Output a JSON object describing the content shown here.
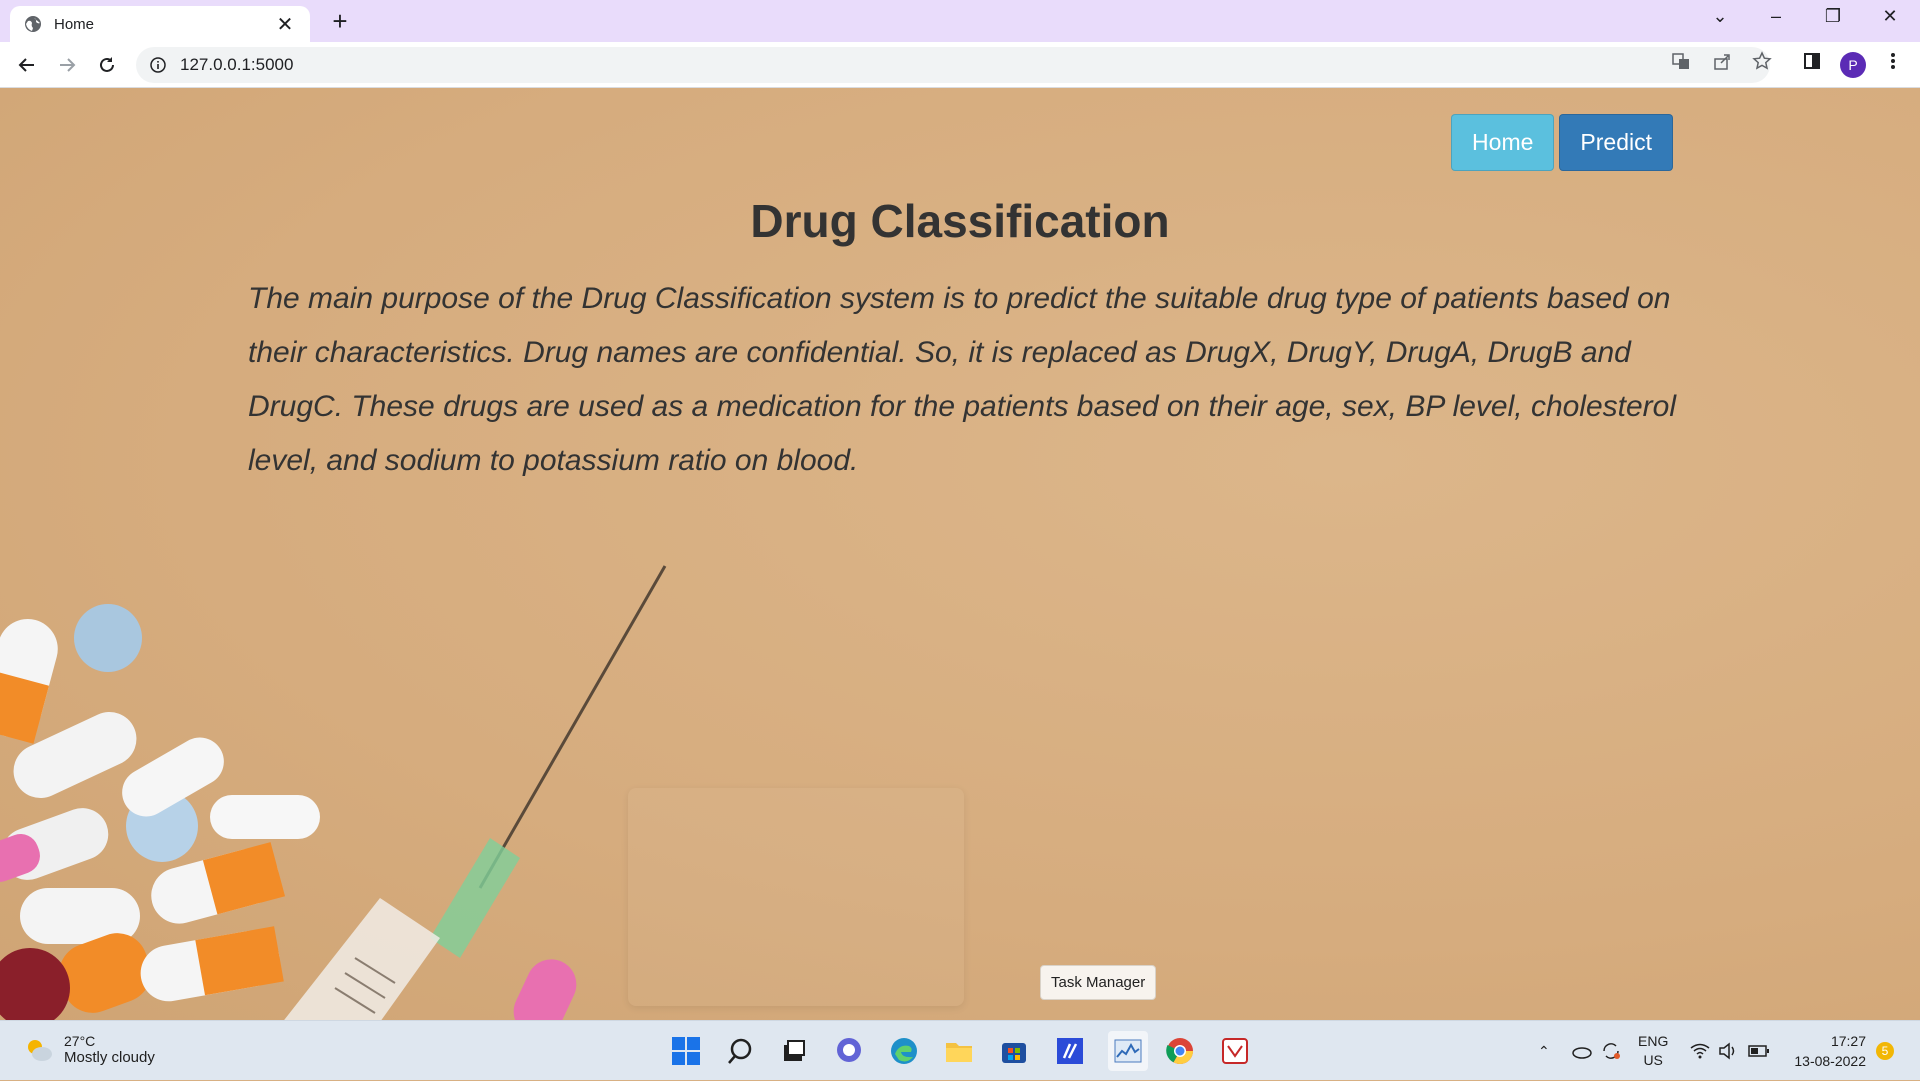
{
  "browser": {
    "tab_title": "Home",
    "url": "127.0.0.1:5000",
    "profile_initial": "P"
  },
  "nav": {
    "home_label": "Home",
    "predict_label": "Predict"
  },
  "main": {
    "title": "Drug Classification",
    "description": "The main purpose of the Drug Classification system is to predict the suitable drug type of patients based on their characteristics. Drug names are confidential. So, it is replaced as DrugX, DrugY, DrugA, DrugB and DrugC. These drugs are used as a medication for the patients based on their age, sex, BP level, cholesterol level, and sodium to potassium ratio on blood."
  },
  "tooltip": "Task Manager",
  "taskbar": {
    "weather_temp": "27°C",
    "weather_condition": "Mostly cloudy",
    "language_top": "ENG",
    "language_bottom": "US",
    "time": "17:27",
    "date": "13-08-2022",
    "notification_count": "5"
  },
  "colors": {
    "home_button": "#5bc0de",
    "predict_button": "#337ab7",
    "background": "#d8b083"
  }
}
